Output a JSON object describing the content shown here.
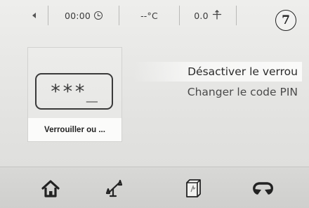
{
  "status_bar": {
    "back_icon": "back-arrow-icon",
    "time": "00:00",
    "time_icon": "clock-icon",
    "temperature": "--°C",
    "wind": "0.0",
    "wind_icon": "wind-icon"
  },
  "badge": "7",
  "lock_tile": {
    "pin_display": "***_",
    "label": "Verrouiller ou ..."
  },
  "menu": {
    "items": [
      {
        "label": "Désactiver le verrou",
        "selected": true
      },
      {
        "label": "Changer le code PIN",
        "selected": false
      }
    ]
  },
  "bottom_nav": {
    "items": [
      {
        "icon": "home-icon"
      },
      {
        "icon": "scale-icon"
      },
      {
        "icon": "book-icon"
      },
      {
        "icon": "return-icon"
      }
    ]
  }
}
